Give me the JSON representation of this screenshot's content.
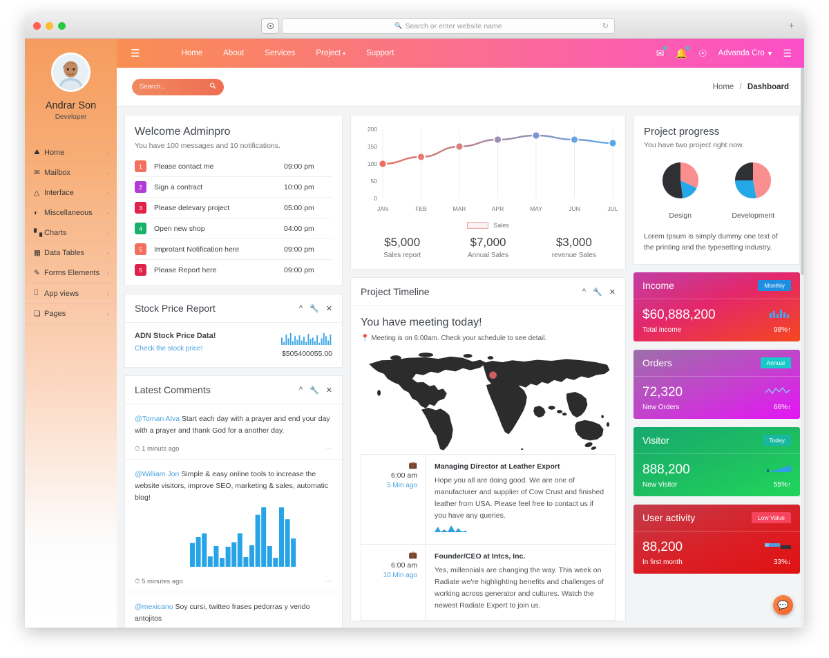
{
  "browser": {
    "url_placeholder": "Search or enter website name",
    "search_icon": "search-icon",
    "reader_icon": "reader-view-icon",
    "reload_icon": "reload-icon",
    "newtab_label": "+"
  },
  "sidebar": {
    "profile": {
      "name": "Andrar Son",
      "role": "Developer",
      "avatar": "user-avatar"
    },
    "items": [
      {
        "icon": "home-icon",
        "label": "Home",
        "chevron": "‹"
      },
      {
        "icon": "mail-icon",
        "label": "Mailbox",
        "chevron": "‹"
      },
      {
        "icon": "cube-icon",
        "label": "Interface",
        "chevron": "‹"
      },
      {
        "icon": "clock-icon",
        "label": "Miscellaneous",
        "chevron": "‹"
      },
      {
        "icon": "chart-icon",
        "label": "Charts",
        "chevron": "‹"
      },
      {
        "icon": "table-icon",
        "label": "Data Tables",
        "chevron": "‹"
      },
      {
        "icon": "pencil-icon",
        "label": "Forms Elements",
        "chevron": "‹"
      },
      {
        "icon": "monitor-icon",
        "label": "App views",
        "chevron": "‹"
      },
      {
        "icon": "copy-icon",
        "label": "Pages",
        "chevron": "‹"
      }
    ]
  },
  "navbar": {
    "hamburger": "☰",
    "links": [
      {
        "label": "Home",
        "caret": ""
      },
      {
        "label": "About",
        "caret": ""
      },
      {
        "label": "Services",
        "caret": ""
      },
      {
        "label": "Project",
        "caret": "▾"
      },
      {
        "label": "Support",
        "caret": ""
      }
    ],
    "message_icon": "message-icon",
    "bell_icon": "bell-icon",
    "user_icon": "user-circle-icon",
    "username": "Advanda Cro",
    "user_caret": "▾",
    "grid_icon": "grid-menu-icon"
  },
  "topbar": {
    "search_placeholder": "Search...",
    "search_icon": "search-icon",
    "breadcrumb_home": "Home",
    "breadcrumb_sep": "/",
    "breadcrumb_current": "Dashboard"
  },
  "welcome": {
    "title": "Welcome Adminpro",
    "subtitle": "You have 100 messages and 10 notifications.",
    "messages": [
      {
        "num": "1",
        "color": "#f2705c",
        "text": "Please contact me",
        "time": "09:00 pm"
      },
      {
        "num": "2",
        "color": "#b23ad6",
        "text": "Sign a contract",
        "time": "10:00 pm"
      },
      {
        "num": "3",
        "color": "#e0214a",
        "text": "Please delevary project",
        "time": "05:00 pm"
      },
      {
        "num": "4",
        "color": "#17b26a",
        "text": "Open new shop",
        "time": "04:00 pm"
      },
      {
        "num": "5",
        "color": "#f2705c",
        "text": "Improtant Notification here",
        "time": "09:00 pm"
      },
      {
        "num": "5",
        "color": "#e0214a",
        "text": "Please Report here",
        "time": "09:00 pm"
      }
    ]
  },
  "chart_data": {
    "type": "line",
    "title": "",
    "xlabel": "",
    "ylabel": "",
    "categories": [
      "JAN",
      "FEB",
      "MAR",
      "APR",
      "MAY",
      "JUN",
      "JUL"
    ],
    "series": [
      {
        "name": "Sales",
        "values": [
          100,
          120,
          150,
          170,
          182,
          170,
          160
        ]
      }
    ],
    "yticks": [
      0,
      50,
      100,
      150,
      200
    ],
    "ylim": [
      0,
      200
    ],
    "grid": "vertical",
    "legend": {
      "position": "bottom",
      "entries": [
        "Sales"
      ]
    },
    "line_gradient": [
      "#ef6c5d",
      "#5aa7e8"
    ],
    "point_colors": [
      "#ef6c5d",
      "#e97a71",
      "#d9807f",
      "#9a8fb0",
      "#7f8fd0",
      "#68a2e3",
      "#5aa7e8"
    ]
  },
  "sales_stats": [
    {
      "value": "$5,000",
      "label": "Sales report"
    },
    {
      "value": "$7,000",
      "label": "Annual Sales"
    },
    {
      "value": "$3,000",
      "label": "revenue Sales"
    }
  ],
  "progress": {
    "title": "Project progress",
    "subtitle": "You have two project right now.",
    "pies": [
      {
        "label": "Design",
        "slices": [
          {
            "name": "pink",
            "value": 32,
            "color": "#fb8f8f"
          },
          {
            "name": "blue",
            "value": 16,
            "color": "#25a8e8"
          },
          {
            "name": "dark",
            "value": 52,
            "color": "#2e3033"
          }
        ]
      },
      {
        "label": "Development",
        "slices": [
          {
            "name": "pink",
            "value": 47,
            "color": "#fb8f8f"
          },
          {
            "name": "blue",
            "value": 28,
            "color": "#25a8e8"
          },
          {
            "name": "dark",
            "value": 25,
            "color": "#2e3033"
          }
        ]
      }
    ],
    "text": "Lorem Ipsum is simply dummy one text of the printing and the typesetting industry."
  },
  "stock": {
    "title": "Stock Price Report",
    "actions": [
      "collapse-icon",
      "wrench-icon",
      "close-icon"
    ],
    "headline": "ADN Stock Price Data!",
    "link": "Check the stock price!",
    "price": "$505400055.00",
    "spark": [
      10,
      4,
      14,
      9,
      16,
      5,
      12,
      7,
      13,
      6,
      11,
      4,
      15,
      8,
      10,
      5,
      13,
      3,
      9,
      16,
      12,
      6,
      14
    ]
  },
  "comments": {
    "title": "Latest Comments",
    "actions": [
      "collapse-icon",
      "wrench-icon",
      "close-icon"
    ],
    "items": [
      {
        "handle": "@Toman Alva",
        "text": "Start each day with a prayer and end your day with a prayer and thank God for a another day.",
        "time": "1 minuts ago",
        "has_chart": false
      },
      {
        "handle": "@William Jon",
        "text": "Simple & easy online tools to increase the website visitors, improve SEO, marketing & sales, automatic blog!",
        "time": "5 minutes ago",
        "has_chart": true,
        "bars": [
          32,
          40,
          45,
          14,
          28,
          12,
          27,
          33,
          45,
          13,
          29,
          70,
          80,
          28,
          12,
          80,
          64,
          38
        ]
      },
      {
        "handle": "@mexicano",
        "text": "Soy cursi, twitteo frases pedorras y vendo antojitos",
        "time": "",
        "has_chart": false
      }
    ]
  },
  "timeline": {
    "title": "Project Timeline",
    "actions": [
      "collapse-icon",
      "wrench-icon",
      "close-icon"
    ],
    "heading": "You have meeting today!",
    "pin_icon": "location-pin-icon",
    "subheading": "Meeting is on 6:00am. Check your schedule to see detail.",
    "map": "world-map",
    "items": [
      {
        "icon": "briefcase-icon",
        "time": "6:00 am",
        "ago": "5 Min ago",
        "title": "Managing Director at Leather Export",
        "body": "Hope you all are doing good. We are one of manufacturer and supplier of Cow Crust and finished leather from USA. Please feel free to contact us if you have any queries.",
        "has_spark": true
      },
      {
        "icon": "briefcase-icon",
        "time": "6:00 am",
        "ago": "10 Min ago",
        "title": "Founder/CEO at Intcs, Inc.",
        "body": "Yes, millennials are changing the way. This week on Radiate we're highlighting benefits and challenges of working across generator and cultures. Watch the newest Radiate Expert to join us.",
        "has_spark": false
      }
    ]
  },
  "stat_cards": [
    {
      "id": "card-income",
      "title": "Income",
      "pill": "Monthly",
      "pill_bg": "#1e8fe0",
      "value": "$60,888,200",
      "caption": "Total income",
      "pct": "98%",
      "arrow": "↑",
      "spark": "bar-spark"
    },
    {
      "id": "card-orders",
      "title": "Orders",
      "pill": "Annual",
      "pill_bg": "#17c9c9",
      "value": "72,320",
      "caption": "New Orders",
      "pct": "66%",
      "arrow": "↑",
      "spark": "line-spark"
    },
    {
      "id": "card-visitor",
      "title": "Visitor",
      "pill": "Today",
      "pill_bg": "#17b7a0",
      "value": "888,200",
      "caption": "New Visitor",
      "pct": "55%",
      "arrow": "↑",
      "spark": "area-spark"
    },
    {
      "id": "card-activity",
      "title": "User activity",
      "pill": "Low Value",
      "pill_bg": "#f5455e",
      "value": "88,200",
      "caption": "In first month",
      "pct": "33%",
      "arrow": "↓",
      "spark": "block-spark"
    }
  ],
  "bottom_peek": {
    "label": ""
  },
  "chat_fab": {
    "icon": "chat-bubble-icon"
  }
}
